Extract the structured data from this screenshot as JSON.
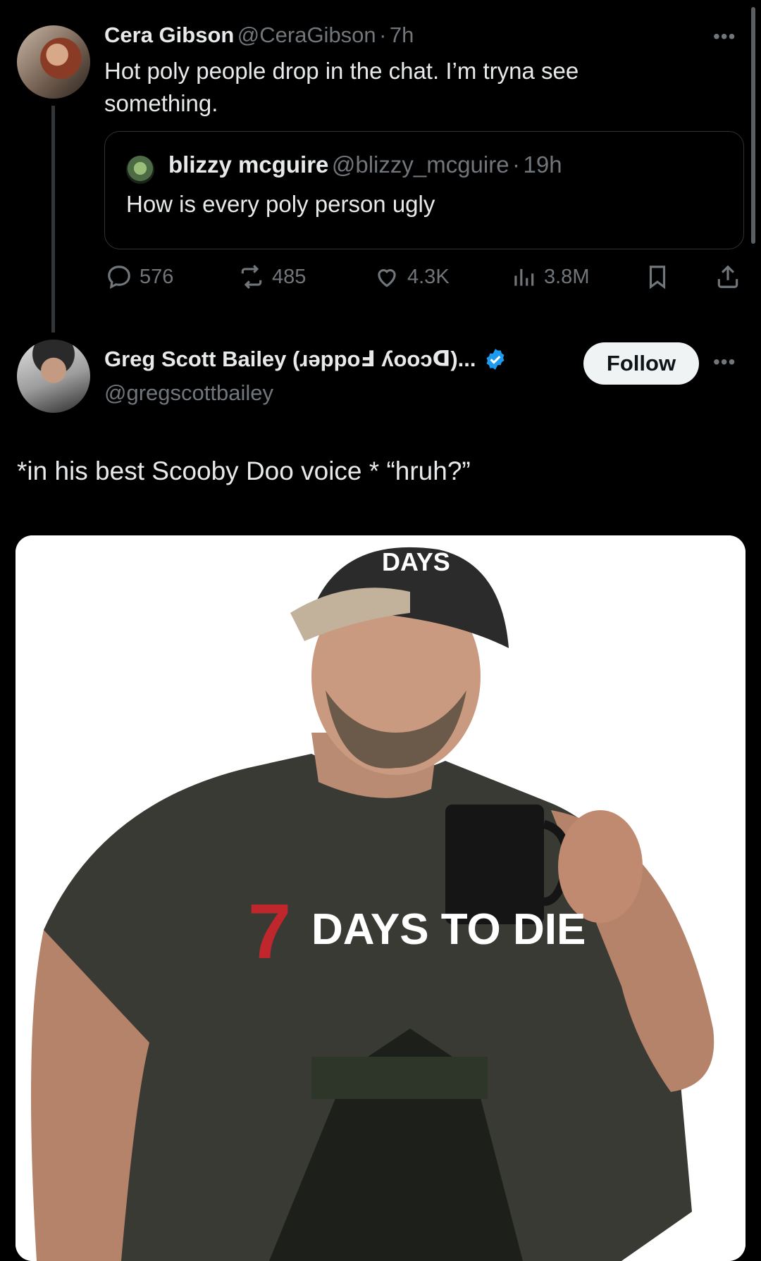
{
  "thread": {
    "first_tweet": {
      "author_name": "Cera Gibson",
      "author_handle": "@CeraGibson",
      "separator": "·",
      "time": "7h",
      "text": "Hot poly people drop in the chat. I’m tryna see something.",
      "more_icon": "more-horizontal-icon",
      "quoted": {
        "author_name": "blizzy mcguire",
        "author_handle": "@blizzy_mcguire",
        "separator": "·",
        "time": "19h",
        "text": "How is every poly person ugly"
      },
      "actions": {
        "replies": "576",
        "reposts": "485",
        "likes": "4.3K",
        "views": "3.8M"
      }
    },
    "reply": {
      "author_name": "Greg Scott Bailey (ɹǝppoℲ ʎooɔᗡ)...",
      "author_handle": "@gregscottbailey",
      "verified": true,
      "follow_label": "Follow",
      "text": "*in his best Scooby Doo voice * “hruh?”",
      "image_text": {
        "cap": "DAYS",
        "shirt": "DAYS TO DIE",
        "shirt_number": "7"
      }
    }
  },
  "colors": {
    "background": "#000000",
    "text_primary": "#e7e9ea",
    "text_secondary": "#71767b",
    "verified_blue": "#1d9bf0",
    "follow_bg": "#eff3f4"
  }
}
